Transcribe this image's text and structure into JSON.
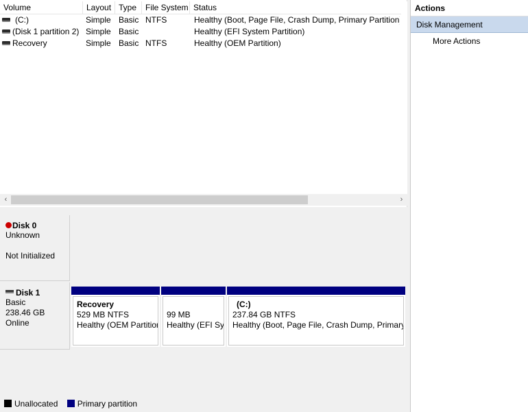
{
  "volume_list": {
    "columns": [
      "Volume",
      "Layout",
      "Type",
      "File System",
      "Status"
    ],
    "rows": [
      {
        "volume": "(C:)",
        "layout": "Simple",
        "type": "Basic",
        "fs": "NTFS",
        "status": "Healthy (Boot, Page File, Crash Dump, Primary Partition)"
      },
      {
        "volume": "(Disk 1 partition 2)",
        "layout": "Simple",
        "type": "Basic",
        "fs": "",
        "status": "Healthy (EFI System Partition)"
      },
      {
        "volume": "Recovery",
        "layout": "Simple",
        "type": "Basic",
        "fs": "NTFS",
        "status": "Healthy (OEM Partition)"
      }
    ]
  },
  "scroll": {
    "left_arrow": "‹",
    "right_arrow": "›"
  },
  "disks": [
    {
      "name": "Disk 0",
      "type": "Unknown",
      "state": "Not Initialized"
    },
    {
      "name": "Disk 1",
      "type": "Basic",
      "size": "238.46 GB",
      "state": "Online",
      "partitions": [
        {
          "title": "Recovery",
          "size": "529 MB NTFS",
          "status": "Healthy (OEM Partition)"
        },
        {
          "title": "",
          "size": "99 MB",
          "status": "Healthy (EFI System Partition)"
        },
        {
          "title": "(C:)",
          "size": "237.84 GB NTFS",
          "status": "Healthy (Boot, Page File, Crash Dump, Primary Partition)"
        }
      ]
    }
  ],
  "legend": [
    {
      "label": "Unallocated",
      "color": "#000000"
    },
    {
      "label": "Primary partition",
      "color": "#000080"
    }
  ],
  "actions": {
    "title": "Actions",
    "section": "Disk Management",
    "more": "More Actions"
  }
}
